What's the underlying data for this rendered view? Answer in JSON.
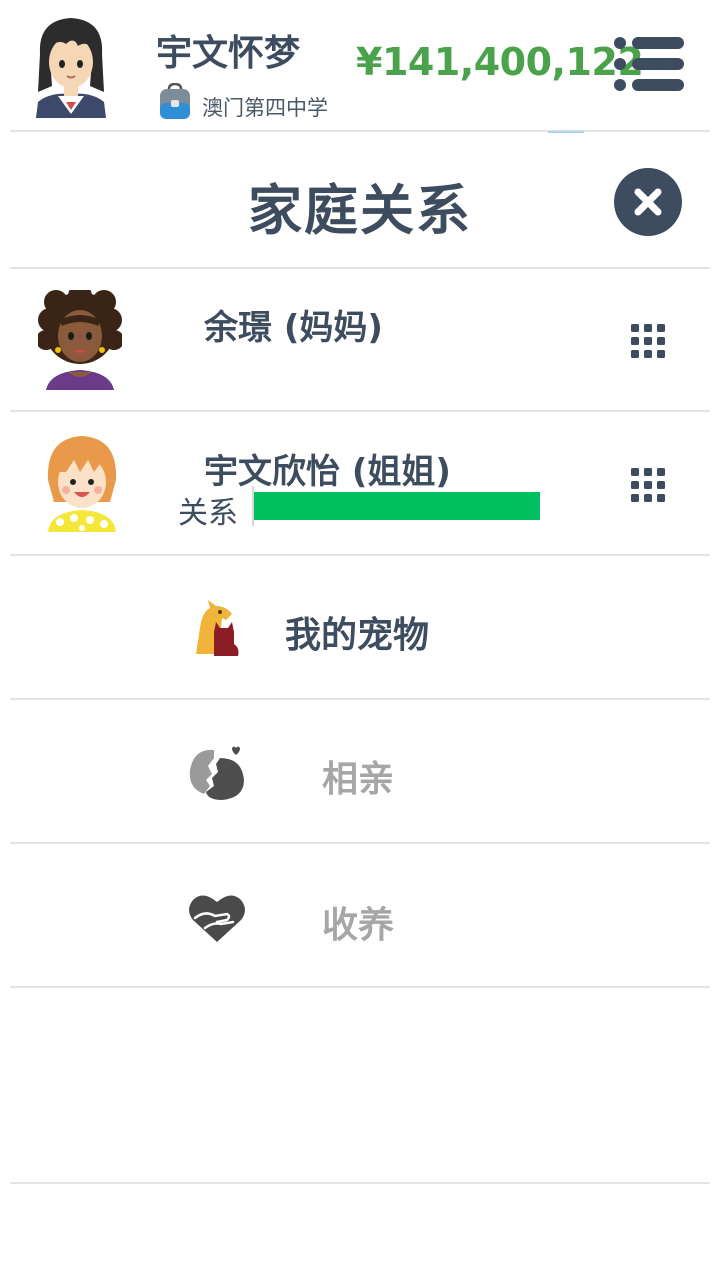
{
  "header": {
    "name": "宇文怀梦",
    "school": "澳门第四中学",
    "money": "¥141,400,122"
  },
  "dialog": {
    "title": "家庭关系"
  },
  "family": [
    {
      "name": "余璟 (妈妈)"
    },
    {
      "name": "宇文欣怡 (姐姐)",
      "relationship_label": "关系",
      "relationship_level": 0.9
    }
  ],
  "actions": [
    {
      "label": "我的宠物",
      "icon": "pet-icon",
      "state": "enabled"
    },
    {
      "label": "相亲",
      "icon": "dating-icon",
      "state": "disabled"
    },
    {
      "label": "收养",
      "icon": "adoption-icon",
      "state": "disabled"
    }
  ],
  "colors": {
    "text_dark": "#3d4d5f",
    "money_green": "#4aa24a",
    "relationship_bar": "#00bf5f",
    "disabled_text": "#a6a6a6"
  }
}
